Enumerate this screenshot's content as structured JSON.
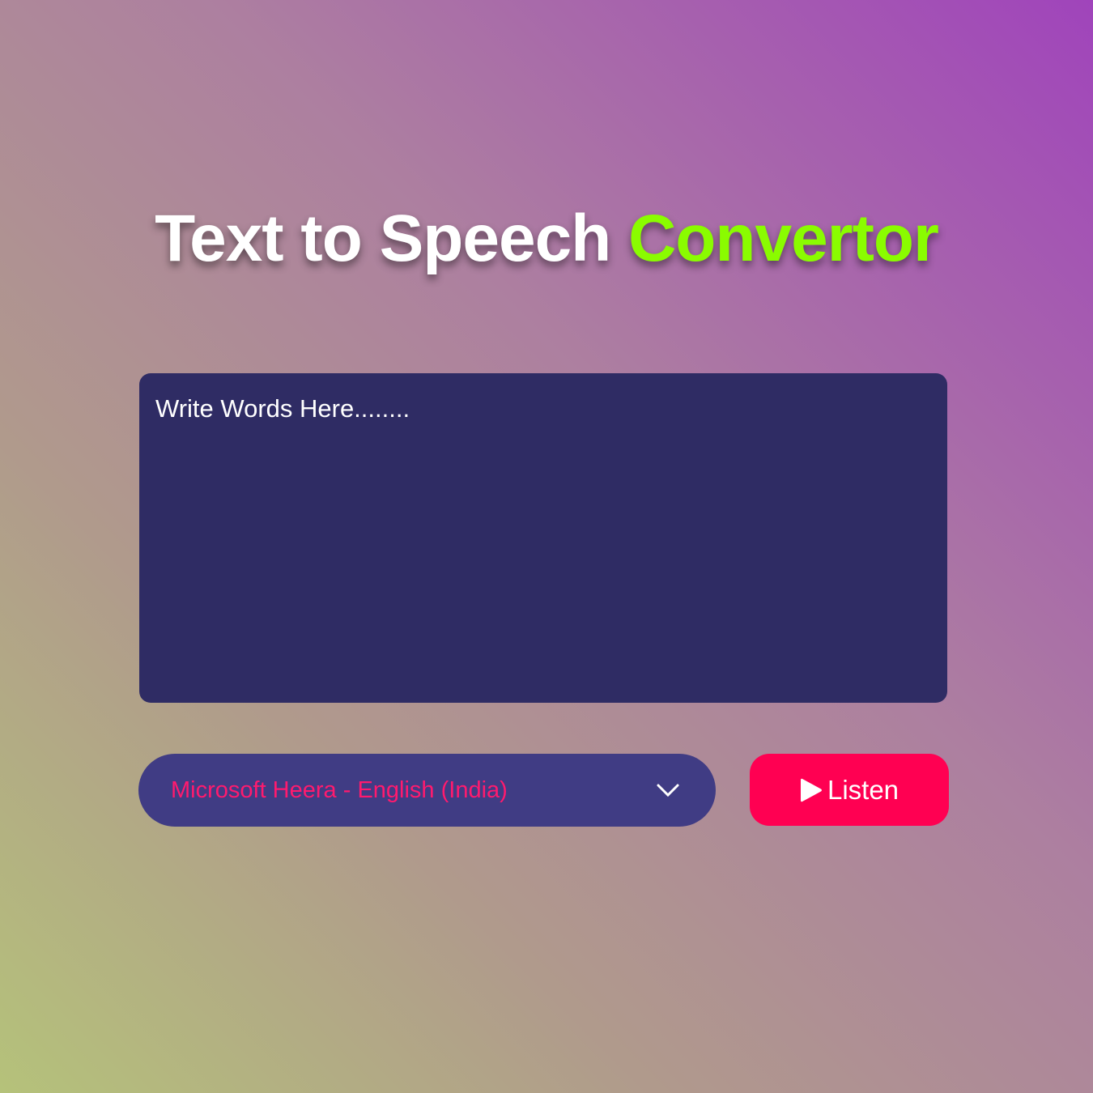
{
  "header": {
    "title_main": "Text to Speech",
    "title_accent": "Convertor"
  },
  "input": {
    "placeholder": "Write Words Here........",
    "value": ""
  },
  "voice_select": {
    "selected": "Microsoft Heera - English (India)"
  },
  "listen_button": {
    "label": "Listen",
    "icon": "play-icon"
  },
  "colors": {
    "accent": "#8afc00",
    "button": "#ff0052",
    "panel": "#2f2c64",
    "select": "#403c84"
  }
}
